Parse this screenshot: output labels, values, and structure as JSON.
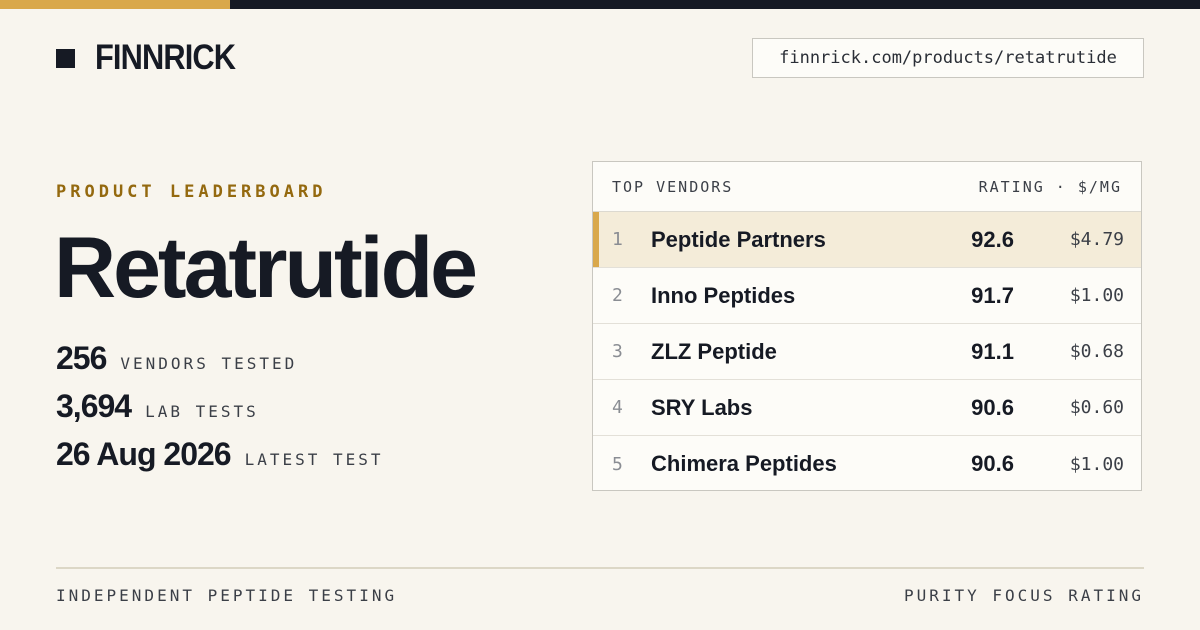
{
  "colors": {
    "accent_gold": "#d9a84b",
    "dark": "#161a24",
    "eyebrow_gold": "#94690f",
    "background": "#f8f5ee",
    "row_highlight": "#f4ecd9"
  },
  "header": {
    "brand_icon": "square-logo-icon",
    "brand_name": "FINNRICK",
    "url": "finnrick.com/products/retatrutide"
  },
  "main": {
    "eyebrow": "PRODUCT LEADERBOARD",
    "title": "Retatrutide",
    "stats": [
      {
        "value": "256",
        "label": "VENDORS TESTED"
      },
      {
        "value": "3,694",
        "label": "LAB TESTS"
      },
      {
        "value": "26 Aug 2026",
        "label": "LATEST TEST"
      }
    ]
  },
  "leaderboard": {
    "header_left": "TOP VENDORS",
    "header_right": "RATING · $/MG",
    "rows": [
      {
        "rank": "1",
        "vendor": "Peptide Partners",
        "rating": "92.6",
        "price": "$4.79"
      },
      {
        "rank": "2",
        "vendor": "Inno Peptides",
        "rating": "91.7",
        "price": "$1.00"
      },
      {
        "rank": "3",
        "vendor": "ZLZ Peptide",
        "rating": "91.1",
        "price": "$0.68"
      },
      {
        "rank": "4",
        "vendor": "SRY Labs",
        "rating": "90.6",
        "price": "$0.60"
      },
      {
        "rank": "5",
        "vendor": "Chimera Peptides",
        "rating": "90.6",
        "price": "$1.00"
      }
    ]
  },
  "footer": {
    "left": "INDEPENDENT PEPTIDE TESTING",
    "right": "PURITY FOCUS RATING"
  }
}
